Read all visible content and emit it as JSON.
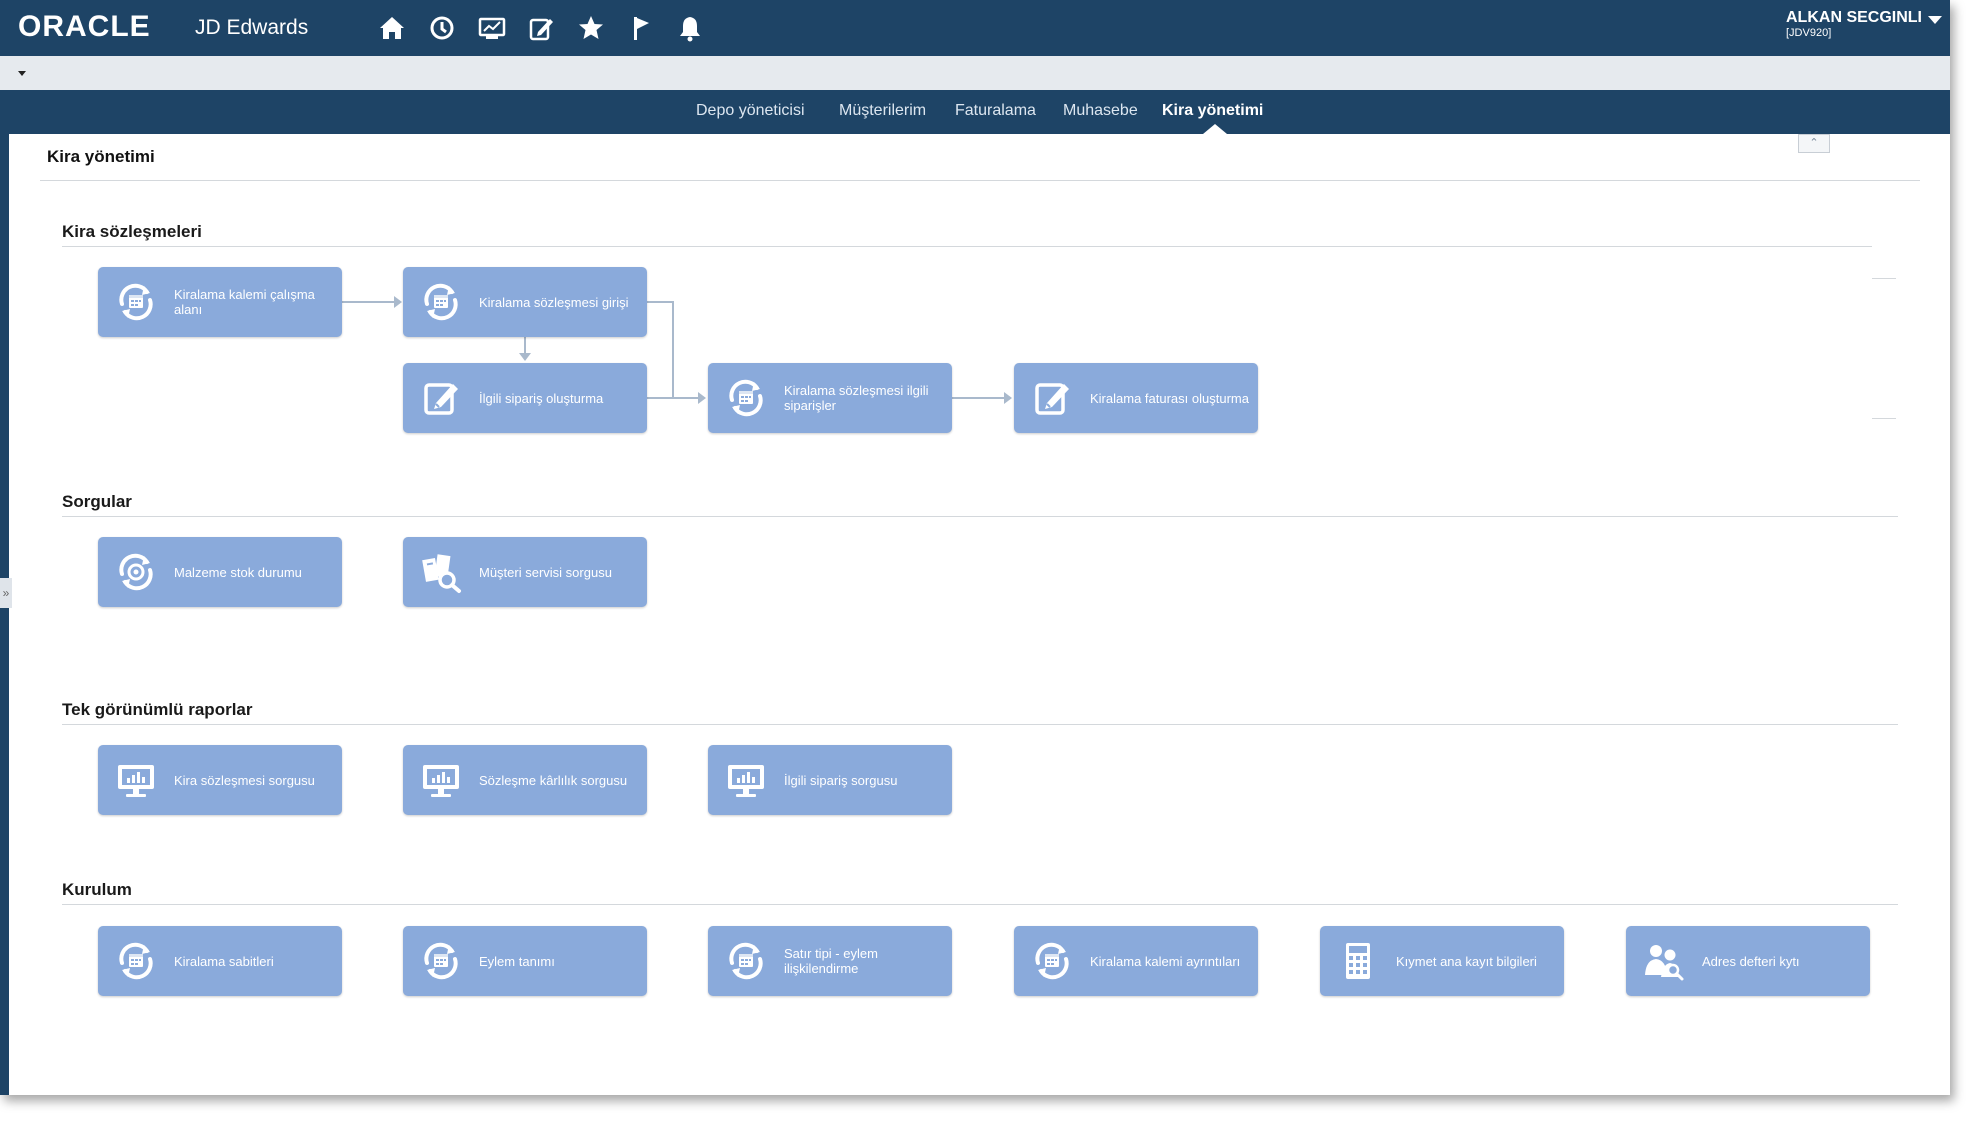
{
  "header": {
    "brand": "ORACLE",
    "product": "JD Edwards",
    "icons": [
      "home-icon",
      "recent-icon",
      "dashboard-icon",
      "edit-icon",
      "favorites-icon",
      "flag-icon",
      "notifications-icon"
    ],
    "user_name": "ALKAN SECGINLI",
    "user_env": "[JDV920]"
  },
  "nav": {
    "tabs": [
      "Depo yöneticisi",
      "Müşterilerim",
      "Faturalama",
      "Muhasebe",
      "Kira yönetimi"
    ],
    "active": "Kira yönetimi"
  },
  "page": {
    "title": "Kira yönetimi"
  },
  "sections": {
    "contracts": {
      "title": "Kira sözleşmeleri",
      "tiles": [
        {
          "label": "Kiralama kalemi çalışma alanı",
          "icon": "calendar-refresh-icon"
        },
        {
          "label": "Kiralama sözleşmesi girişi",
          "icon": "calendar-refresh-icon"
        },
        {
          "label": "İlgili sipariş oluşturma",
          "icon": "edit-icon"
        },
        {
          "label": "Kiralama sözleşmesi ilgili siparişler",
          "icon": "calendar-refresh-icon"
        },
        {
          "label": "Kiralama faturası oluşturma",
          "icon": "edit-icon"
        }
      ]
    },
    "queries": {
      "title": "Sorgular",
      "tiles": [
        {
          "label": "Malzeme stok durumu",
          "icon": "target-refresh-icon"
        },
        {
          "label": "Müşteri servisi sorgusu",
          "icon": "search-documents-icon"
        }
      ]
    },
    "reports": {
      "title": "Tek görünümlü raporlar",
      "tiles": [
        {
          "label": "Kira sözleşmesi sorgusu",
          "icon": "monitor-chart-icon"
        },
        {
          "label": "Sözleşme kârlılık sorgusu",
          "icon": "monitor-chart-icon"
        },
        {
          "label": "İlgili sipariş sorgusu",
          "icon": "monitor-chart-icon"
        }
      ]
    },
    "setup": {
      "title": "Kurulum",
      "tiles": [
        {
          "label": "Kiralama sabitleri",
          "icon": "calendar-refresh-icon"
        },
        {
          "label": "Eylem tanımı",
          "icon": "calendar-refresh-icon"
        },
        {
          "label": "Satır tipi - eylem ilişkilendirme",
          "icon": "calendar-refresh-icon"
        },
        {
          "label": "Kiralama kalemi ayrıntıları",
          "icon": "calendar-refresh-icon"
        },
        {
          "label": "Kıymet ana kayıt bilgileri",
          "icon": "calculator-icon"
        },
        {
          "label": "Adres defteri kytı",
          "icon": "people-search-icon"
        }
      ]
    }
  },
  "colors": {
    "header_bg": "#1e4466",
    "tile_bg": "#8aaadb",
    "connector": "#a9b9cc"
  }
}
